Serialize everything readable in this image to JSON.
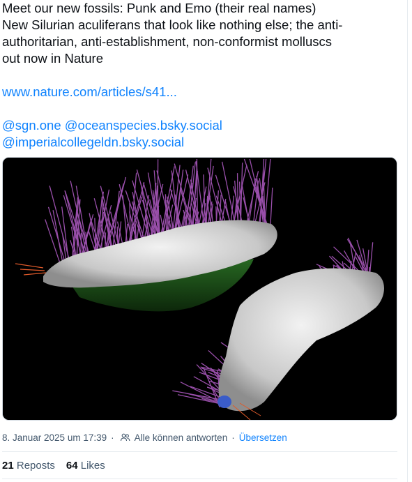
{
  "post": {
    "lines": [
      "Meet our new fossils: Punk and Emo (their real names)",
      "New Silurian aculiferans that look like nothing else; the anti-",
      "authoritarian, anti-establishment, non-conformist molluscs",
      "out now in Nature"
    ],
    "link": "www.nature.com/articles/s41...",
    "mention_line_1": "@sgn.one @oceanspecies.bsky.social",
    "mention_line_2": "@imperialcollegeldn.bsky.social"
  },
  "meta": {
    "timestamp": "8. Januar 2025 um 17:39",
    "separator": "·",
    "reply_setting": "Alle können antworten",
    "translate_label": "Übersetzen",
    "people_icon": "people-icon"
  },
  "stats": {
    "reposts_count": "21",
    "reposts_label": "Reposts",
    "likes_count": "64",
    "likes_label": "Likes"
  },
  "colors": {
    "link": "#1083fe",
    "muted": "#42576c",
    "text": "#0b0f14",
    "fossil_bristles": "#b45dc8",
    "fossil_body": "#d8d8d8",
    "background_media": "#000000"
  }
}
